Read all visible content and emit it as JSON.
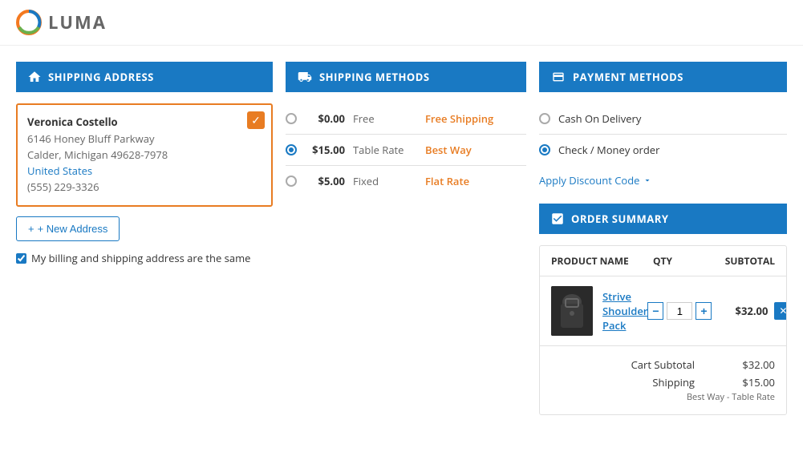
{
  "brand": {
    "name": "LUMA"
  },
  "shipping_address": {
    "section_title": "SHIPPING ADDRESS",
    "address": {
      "name": "Veronica Costello",
      "street": "6146 Honey Bluff Parkway",
      "city_state_zip": "Calder, Michigan 49628-7978",
      "country": "United States",
      "phone": "(555) 229-3326"
    },
    "new_address_btn": "+ New Address",
    "billing_same_label": "My billing and shipping address are the same"
  },
  "shipping_methods": {
    "section_title": "SHIPPING METHODS",
    "methods": [
      {
        "id": "free",
        "price": "$0.00",
        "type": "Free",
        "name": "Free Shipping",
        "selected": false
      },
      {
        "id": "table",
        "price": "$15.00",
        "type": "Table Rate",
        "name": "Best Way",
        "selected": true
      },
      {
        "id": "fixed",
        "price": "$5.00",
        "type": "Fixed",
        "name": "Flat Rate",
        "selected": false
      }
    ]
  },
  "payment_methods": {
    "section_title": "PAYMENT METHODS",
    "methods": [
      {
        "id": "cod",
        "label": "Cash On Delivery",
        "selected": false
      },
      {
        "id": "check",
        "label": "Check / Money order",
        "selected": true
      }
    ],
    "discount_label": "Apply Discount Code"
  },
  "order_summary": {
    "section_title": "ORDER SUMMARY",
    "columns": [
      "PRODUCT NAME",
      "QTY",
      "SUBTOTAL"
    ],
    "items": [
      {
        "id": "strive",
        "name": "Strive Shoulder Pack",
        "qty": 1,
        "subtotal": "$32.00"
      }
    ],
    "totals": [
      {
        "label": "Cart Subtotal",
        "value": "$32.00"
      },
      {
        "label": "Shipping",
        "value": "$15.00"
      }
    ],
    "shipping_detail": "Best Way - Table Rate"
  }
}
